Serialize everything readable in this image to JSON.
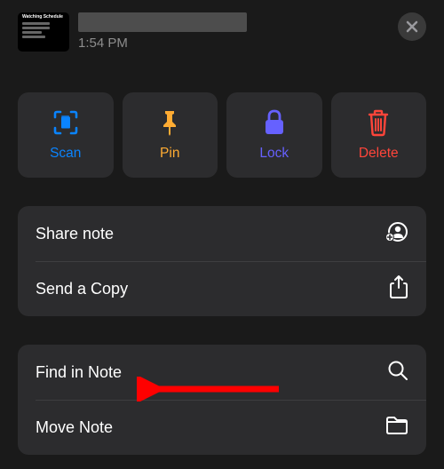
{
  "header": {
    "thumbnail_title": "Watching Schedule",
    "timestamp": "1:54 PM"
  },
  "actions": {
    "scan": "Scan",
    "pin": "Pin",
    "lock": "Lock",
    "delete": "Delete"
  },
  "menu_group1": {
    "share": "Share note",
    "copy": "Send a Copy"
  },
  "menu_group2": {
    "find": "Find in Note",
    "move": "Move Note"
  },
  "icons": {
    "close": "close-icon",
    "share_person": "share-person-icon",
    "export": "export-icon",
    "search": "search-icon",
    "folder": "folder-icon"
  },
  "colors": {
    "accent_blue": "#0a84ff",
    "accent_yellow": "#ffac33",
    "accent_purple": "#6661ff",
    "accent_red": "#ff453a"
  }
}
